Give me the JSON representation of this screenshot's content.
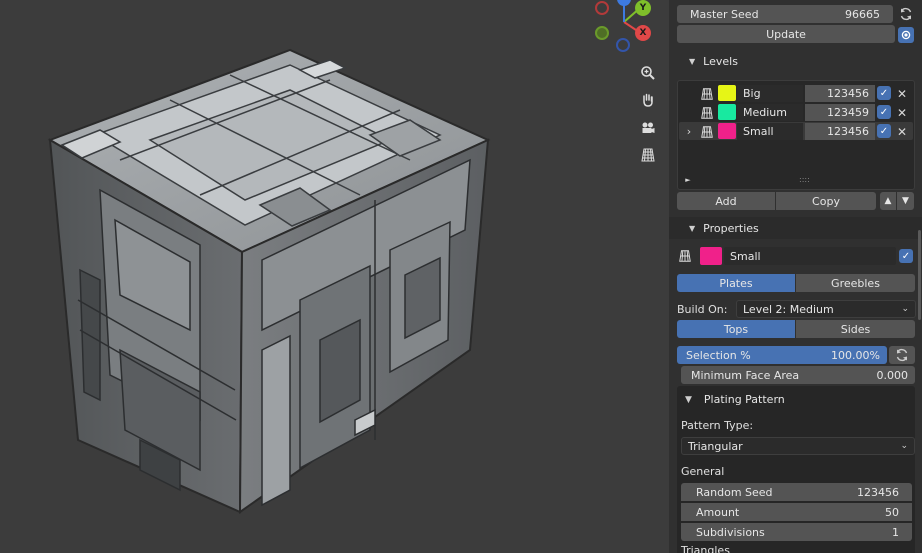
{
  "gizmo": {
    "y_label": "Y",
    "x_label": "X"
  },
  "nav_icons": [
    "zoom-icon",
    "hand-icon",
    "camera-icon",
    "grid-icon"
  ],
  "panel": {
    "master_seed": {
      "label": "Master Seed",
      "value": "96665"
    },
    "update_label": "Update",
    "levels": {
      "title": "Levels",
      "rows": [
        {
          "name": "Big",
          "seed": "123456",
          "color": "#e6f516"
        },
        {
          "name": "Medium",
          "seed": "123459",
          "color": "#18e9a0"
        },
        {
          "name": "Small",
          "seed": "123456",
          "color": "#f0218a"
        }
      ],
      "list_handle": "::::",
      "add_label": "Add",
      "copy_label": "Copy"
    },
    "properties": {
      "title": "Properties",
      "selected_name": "Small",
      "selected_color": "#f0218a",
      "tabs": [
        "Plates",
        "Greebles"
      ],
      "build_on_label": "Build On:",
      "build_on_value": "Level 2: Medium",
      "face_tabs": [
        "Tops",
        "Sides"
      ],
      "selection": {
        "label": "Selection %",
        "value": "100.00%",
        "fraction": 1.0
      },
      "min_face_area": {
        "label": "Minimum Face Area",
        "value": "0.000"
      },
      "plating_pattern": {
        "title": "Plating Pattern",
        "pattern_type_label": "Pattern Type:",
        "pattern_type_value": "Triangular",
        "general_label": "General",
        "random_seed": {
          "label": "Random Seed",
          "value": "123456"
        },
        "amount": {
          "label": "Amount",
          "value": "50"
        },
        "subdivisions": {
          "label": "Subdivisions",
          "value": "1"
        },
        "triangles_label": "Triangles"
      }
    }
  },
  "colors": {
    "accent": "#4772b3",
    "panel_bg": "#303030",
    "field_bg": "#545454",
    "viewport_bg": "#3c3c3c"
  }
}
